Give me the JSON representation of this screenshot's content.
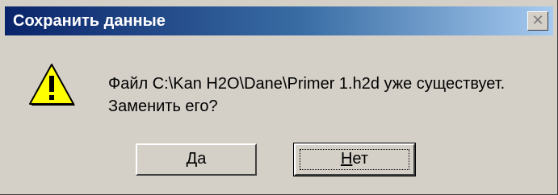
{
  "dialog": {
    "title": "Сохранить данные",
    "close_symbol": "✕",
    "icon": "warning-icon",
    "message_line1": "Файл C:\\Kan H2O\\Dane\\Primer 1.h2d уже существует.",
    "message_line2": "Заменить его?",
    "buttons": {
      "yes_mnemonic": "Д",
      "yes_rest": "а",
      "no_mnemonic": "Н",
      "no_rest": "ет"
    }
  },
  "colors": {
    "title_start": "#0a246a",
    "title_end": "#a6caf0",
    "face": "#d4d0c8",
    "warning_fill": "#ffff00"
  }
}
